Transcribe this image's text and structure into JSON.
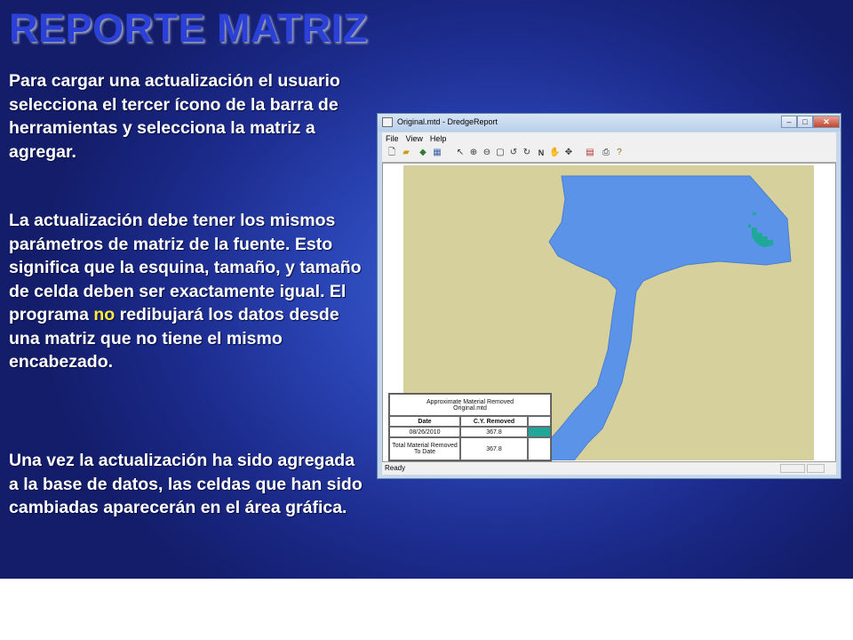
{
  "slide": {
    "title": "REPORTE MATRIZ",
    "paragraph1": "Para cargar una actualización el usuario selecciona el tercer ícono de la barra de herramientas y selecciona la matriz a agregar.",
    "paragraph2_before": "La actualización debe tener los mismos parámetros de matriz de la fuente. Esto significa que la esquina, tamaño, y tamaño de celda deben ser exactamente igual. El programa ",
    "paragraph2_highlight": "no",
    "paragraph2_after": "  redibujará los datos desde una matriz que no tiene el mismo encabezado.",
    "paragraph3": "Una vez la actualización ha sido agregada a la base de datos, las celdas que han sido cambiadas aparecerán en el área gráfica."
  },
  "window": {
    "title": "Original.mtd - DredgeReport",
    "menu": [
      "File",
      "View",
      "Help"
    ],
    "status": "Ready"
  },
  "toolbar_icons": [
    "new-file-icon",
    "open-folder-icon",
    "add-update-icon",
    "chart-icon",
    "properties-icon",
    "pointer-icon",
    "zoom-in-icon",
    "zoom-out-icon",
    "zoom-box-icon",
    "rotate-left-icon",
    "rotate-right-icon",
    "north-icon",
    "pan-icon",
    "pan-tool-icon",
    "refresh-icon",
    "export-icon",
    "print-icon",
    "help-icon"
  ],
  "report": {
    "title_line1": "Approximate Material Removed",
    "title_line2": "Original.mtd",
    "col_date": "Date",
    "col_cy": "C.Y. Removed",
    "row_date": "08/26/2010",
    "row_value": "367.8",
    "total_label": "Total Material Removed To Date",
    "total_value": "367.8"
  },
  "colors": {
    "title": "#2b40d6",
    "highlight": "#ffeb3b",
    "map_land": "#d6d09c",
    "map_water": "#5b93e8",
    "changed_cells": "#1fa89a"
  }
}
